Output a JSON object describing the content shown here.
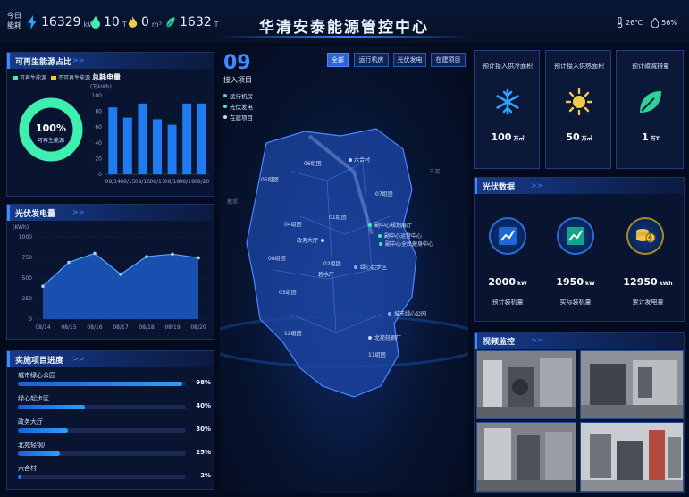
{
  "header": {
    "title": "华清安泰能源管控中心",
    "today_label_line1": "今日",
    "today_label_line2": "能耗",
    "stats": [
      {
        "value": "16329",
        "unit": "kWh",
        "icon": "lightning-icon"
      },
      {
        "value": "10",
        "unit": "T",
        "icon": "water-drop-icon"
      },
      {
        "value": "0",
        "unit": "m³",
        "icon": "flame-icon"
      },
      {
        "value": "1632",
        "unit": "T",
        "icon": "leaf-icon"
      }
    ],
    "temperature": "26℃",
    "humidity": "56%"
  },
  "renewable": {
    "title": "可再生能源占比",
    "legend": [
      "可再生能源",
      "不可再生能源"
    ],
    "ring_percent": "100%",
    "ring_label": "可再生能源",
    "ring_fraction": 1.0,
    "bar_title": "总耗电量",
    "bar_unit": "(万kWh)",
    "colors": {
      "renewable": "#3ef0b0",
      "non_renewable": "#f2c94c"
    }
  },
  "pv": {
    "title": "光伏发电量",
    "unit": "(KWh)"
  },
  "progress": {
    "title": "实施项目进度",
    "items": [
      {
        "name": "城市绿心公园",
        "pct": "98%",
        "value": 0.98
      },
      {
        "name": "绿心起步区",
        "pct": "40%",
        "value": 0.4
      },
      {
        "name": "政务大厅",
        "pct": "30%",
        "value": 0.3
      },
      {
        "name": "北苑轻钢厂",
        "pct": "25%",
        "value": 0.25
      },
      {
        "name": "六合村",
        "pct": "2%",
        "value": 0.02
      }
    ]
  },
  "map": {
    "count": "09",
    "count_label": "接入项目",
    "legend": [
      {
        "label": "运行机房",
        "color": "#6fb6ff"
      },
      {
        "label": "光伏发电",
        "color": "#3ef0b0"
      },
      {
        "label": "在建项目",
        "color": "#c9d4e8"
      }
    ],
    "filters": [
      "全部",
      "运行机房",
      "光伏发电",
      "在建项目"
    ],
    "districts": [
      "06组团",
      "05组团",
      "07组团",
      "04组团",
      "01组团",
      "08组团",
      "02组团",
      "03组团",
      "12组团",
      "11组团"
    ],
    "points": [
      "六合村",
      "政务大厅",
      "副中心规划展厅",
      "副中心运营中心",
      "副中心全民健身中心",
      "绿心起步区",
      "碧水厂",
      "城市绿心公园",
      "北苑轻钢厂"
    ],
    "outer_labels": [
      "三河",
      "燕郊"
    ]
  },
  "right_top": {
    "cards": [
      {
        "title": "预计接入供冷面积",
        "value": "100",
        "unit": "万㎡",
        "icon": "snowflake-icon"
      },
      {
        "title": "预计接入供热面积",
        "value": "50",
        "unit": "万㎡",
        "icon": "sun-icon"
      },
      {
        "title": "预计碳减排量",
        "value": "1",
        "unit": "万T",
        "icon": "leaf-icon"
      }
    ]
  },
  "solar": {
    "title": "光伏数据",
    "items": [
      {
        "value": "2000",
        "unit": "kW",
        "label": "预计装机量",
        "icon": "chart-icon"
      },
      {
        "value": "1950",
        "unit": "kW",
        "label": "实际装机量",
        "icon": "chart-icon"
      },
      {
        "value": "12950",
        "unit": "kWh",
        "label": "累计发电量",
        "icon": "coins-icon"
      }
    ]
  },
  "video": {
    "title": "视频监控"
  },
  "chart_data": [
    {
      "type": "bar",
      "title": "总耗电量",
      "ylabel": "(万kWh)",
      "categories": [
        "08/14",
        "08/15",
        "08/16",
        "08/17",
        "08/18",
        "08/19",
        "08/20"
      ],
      "values": [
        85,
        72,
        90,
        70,
        63,
        90,
        90
      ],
      "ylim": [
        0,
        100
      ],
      "yticks": [
        "0",
        "20",
        "40",
        "60",
        "80",
        "100"
      ]
    },
    {
      "type": "area",
      "title": "光伏发电量",
      "ylabel": "(KWh)",
      "categories": [
        "08/14",
        "08/15",
        "08/16",
        "08/17",
        "08/18",
        "08/19",
        "08/20"
      ],
      "values": [
        400,
        690,
        800,
        545,
        760,
        790,
        745
      ],
      "ylim": [
        0,
        1000
      ],
      "yticks": [
        "0",
        "250",
        "500",
        "750",
        "1000"
      ]
    }
  ]
}
